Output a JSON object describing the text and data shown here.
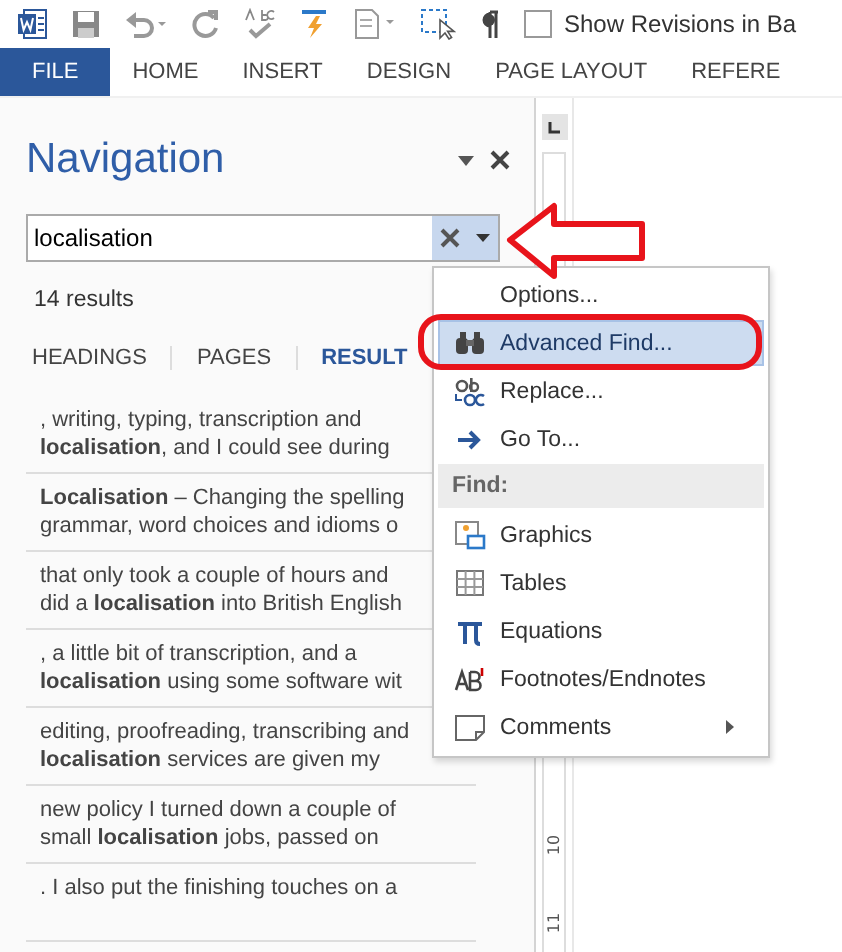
{
  "toolbar": {
    "checkbox": {
      "label": "Show Revisions in Ba",
      "checked": false
    }
  },
  "ribbon_tabs": [
    {
      "label": "FILE",
      "selected": true
    },
    {
      "label": "HOME",
      "selected": false
    },
    {
      "label": "INSERT",
      "selected": false
    },
    {
      "label": "DESIGN",
      "selected": false
    },
    {
      "label": "PAGE LAYOUT",
      "selected": false
    },
    {
      "label": "REFERE",
      "selected": false
    }
  ],
  "navigation": {
    "title": "Navigation",
    "search": {
      "value": "localisation"
    },
    "results_count": "14 results",
    "tabs": [
      {
        "label": "HEADINGS",
        "selected": false
      },
      {
        "label": "PAGES",
        "selected": false
      },
      {
        "label": "RESULT",
        "selected": true
      }
    ],
    "results": [
      {
        "lines": [
          ", writing, typing, transcription and",
          "**localisation**, and I could see during"
        ]
      },
      {
        "lines": [
          "**Localisation** – Changing the spelling",
          "grammar, word choices and idioms o"
        ]
      },
      {
        "lines": [
          "that only took a couple of hours and",
          "did a **localisation** into British English"
        ]
      },
      {
        "lines": [
          ", a little bit of transcription, and a",
          "**localisation** using some software wit"
        ]
      },
      {
        "lines": [
          "editing, proofreading, transcribing and",
          "**localisation** services are given my"
        ]
      },
      {
        "lines": [
          "new policy I turned down a couple of",
          "small **localisation** jobs, passed on"
        ]
      },
      {
        "lines": [
          ". I also put the finishing touches on a"
        ]
      }
    ]
  },
  "menu": {
    "items": [
      {
        "kind": "item",
        "label": "Options...",
        "selected": false,
        "submenu": false
      },
      {
        "kind": "item",
        "label": "Advanced Find...",
        "selected": true,
        "submenu": false
      },
      {
        "kind": "item",
        "label": "Replace...",
        "selected": false,
        "submenu": false
      },
      {
        "kind": "item",
        "label": "Go To...",
        "selected": false,
        "submenu": false
      },
      {
        "kind": "header",
        "label": "Find:"
      },
      {
        "kind": "item",
        "label": "Graphics",
        "selected": false,
        "submenu": false
      },
      {
        "kind": "item",
        "label": "Tables",
        "selected": false,
        "submenu": false
      },
      {
        "kind": "item",
        "label": "Equations",
        "selected": false,
        "submenu": false
      },
      {
        "kind": "item",
        "label": "Footnotes/Endnotes",
        "selected": false,
        "submenu": false
      },
      {
        "kind": "item",
        "label": "Comments",
        "selected": false,
        "submenu": true
      }
    ]
  },
  "ruler": {
    "labels": [
      "10",
      "11"
    ]
  }
}
